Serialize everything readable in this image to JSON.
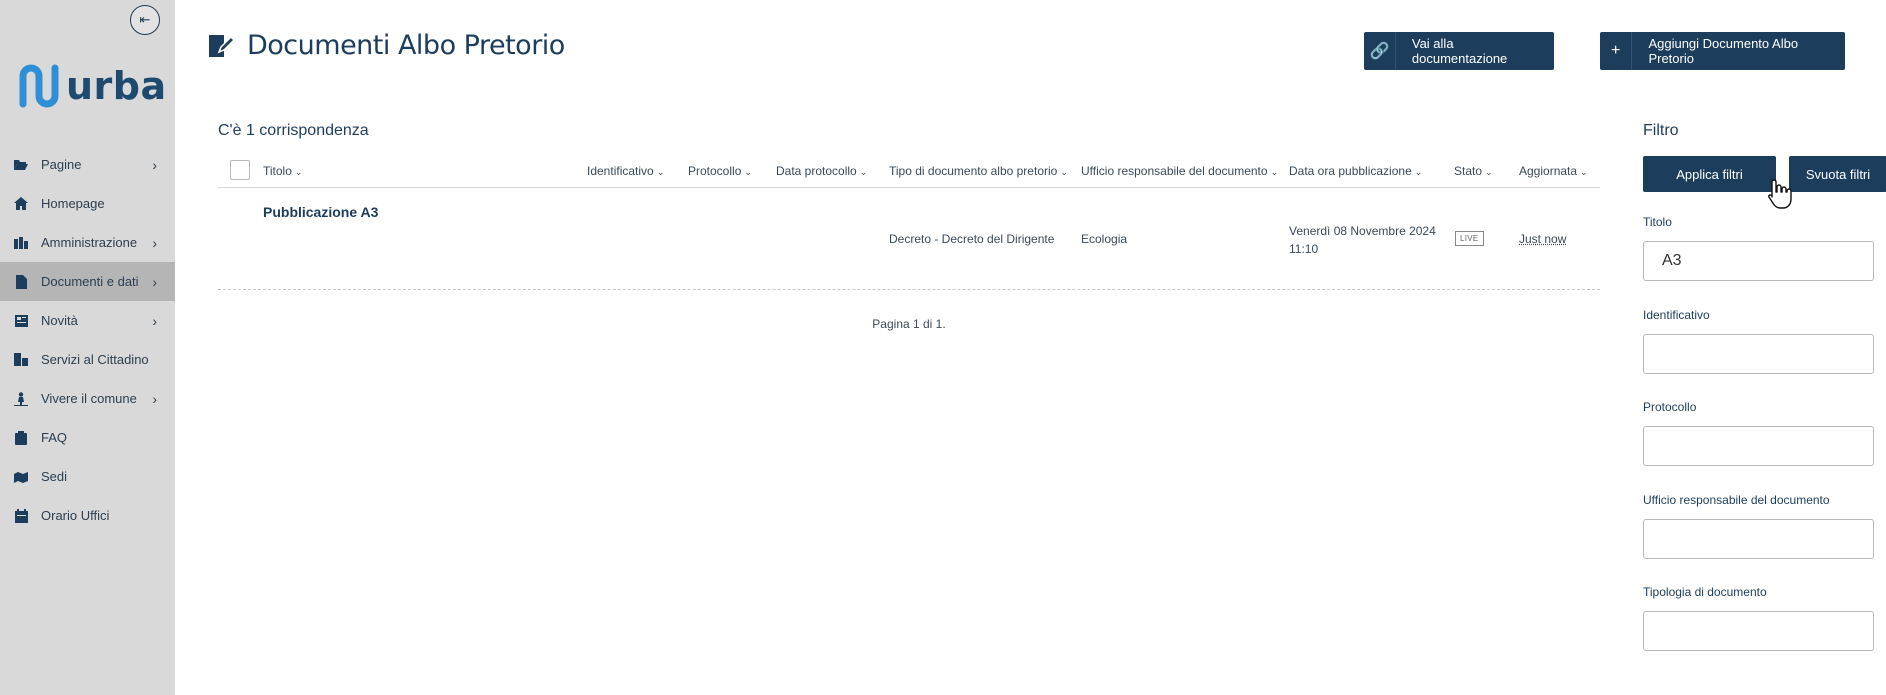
{
  "sidebar": {
    "collapse_icon": "arrow-left-to-line-icon",
    "logo_text": "urba",
    "items": [
      {
        "label": "Pagine",
        "icon": "folder-open-icon",
        "has_children": true
      },
      {
        "label": "Homepage",
        "icon": "home-icon",
        "has_children": false
      },
      {
        "label": "Amministrazione",
        "icon": "building-icon",
        "has_children": true
      },
      {
        "label": "Documenti e dati",
        "icon": "file-icon",
        "has_children": true,
        "active": true
      },
      {
        "label": "Novità",
        "icon": "newspaper-icon",
        "has_children": true
      },
      {
        "label": "Servizi al Cittadino",
        "icon": "city-icon",
        "has_children": false
      },
      {
        "label": "Vivere il comune",
        "icon": "person-icon",
        "has_children": true
      },
      {
        "label": "FAQ",
        "icon": "clipboard-icon",
        "has_children": false
      },
      {
        "label": "Sedi",
        "icon": "map-marker-icon",
        "has_children": false
      },
      {
        "label": "Orario Uffici",
        "icon": "calendar-icon",
        "has_children": false
      }
    ]
  },
  "header": {
    "title": "Documenti Albo Pretorio",
    "docs_button": "Vai alla documentazione",
    "add_button": "Aggiungi Documento Albo Pretorio"
  },
  "results": {
    "count_text": "C'è 1 corrispondenza",
    "columns": [
      "Titolo",
      "Identificativo",
      "Protocollo",
      "Data protocollo",
      "Tipo di documento albo pretorio",
      "Ufficio responsabile del documento",
      "Data ora pubblicazione",
      "Stato",
      "Aggiornata"
    ],
    "rows": [
      {
        "titolo": "Pubblicazione A3",
        "tipo": "Decreto - Decreto del Dirigente",
        "ufficio": "Ecologia",
        "data_line1": "Venerdì 08 Novembre 2024",
        "data_line2": "11:10",
        "stato": "LIVE",
        "aggiornata": "Just now"
      }
    ],
    "pager": "Pagina 1 di 1."
  },
  "filters": {
    "title": "Filtro",
    "apply_button": "Applica filtri",
    "clear_button": "Svuota filtri",
    "fields": [
      {
        "label": "Titolo",
        "value": "A3"
      },
      {
        "label": "Identificativo",
        "value": ""
      },
      {
        "label": "Protocollo",
        "value": ""
      },
      {
        "label": "Ufficio responsabile del documento",
        "value": ""
      },
      {
        "label": "Tipologia di documento",
        "value": ""
      }
    ]
  },
  "colors": {
    "primary": "#1d3d5c",
    "sidebar_bg": "#d9d9d9",
    "sidebar_active": "#b5b5b5",
    "logo_accent": "#2f8fd6"
  }
}
